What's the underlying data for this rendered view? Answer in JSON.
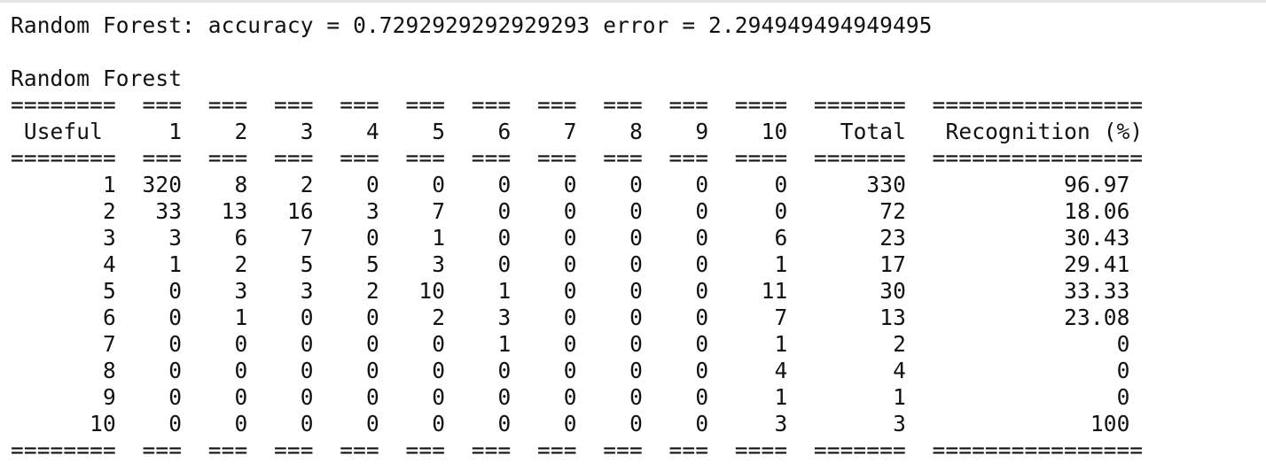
{
  "output": {
    "summary_line": "Random Forest: accuracy = 0.7292929292929293 error = 2.294949494949495",
    "table_title": "Random Forest",
    "separator": "========  ===  ===  ===  ===  ===  ===  ===  ===  ===  ====  =======  ================",
    "columns": [
      "Useful",
      "1",
      "2",
      "3",
      "4",
      "5",
      "6",
      "7",
      "8",
      "9",
      "10",
      "Total",
      "Recognition (%)"
    ],
    "rows": [
      [
        "1",
        "320",
        "8",
        "2",
        "0",
        "0",
        "0",
        "0",
        "0",
        "0",
        "0",
        "330",
        "96.97"
      ],
      [
        "2",
        "33",
        "13",
        "16",
        "3",
        "7",
        "0",
        "0",
        "0",
        "0",
        "0",
        "72",
        "18.06"
      ],
      [
        "3",
        "3",
        "6",
        "7",
        "0",
        "1",
        "0",
        "0",
        "0",
        "0",
        "6",
        "23",
        "30.43"
      ],
      [
        "4",
        "1",
        "2",
        "5",
        "5",
        "3",
        "0",
        "0",
        "0",
        "0",
        "1",
        "17",
        "29.41"
      ],
      [
        "5",
        "0",
        "3",
        "3",
        "2",
        "10",
        "1",
        "0",
        "0",
        "0",
        "11",
        "30",
        "33.33"
      ],
      [
        "6",
        "0",
        "1",
        "0",
        "0",
        "2",
        "3",
        "0",
        "0",
        "0",
        "7",
        "13",
        "23.08"
      ],
      [
        "7",
        "0",
        "0",
        "0",
        "0",
        "0",
        "1",
        "0",
        "0",
        "0",
        "1",
        "2",
        "0"
      ],
      [
        "8",
        "0",
        "0",
        "0",
        "0",
        "0",
        "0",
        "0",
        "0",
        "0",
        "4",
        "4",
        "0"
      ],
      [
        "9",
        "0",
        "0",
        "0",
        "0",
        "0",
        "0",
        "0",
        "0",
        "0",
        "1",
        "1",
        "0"
      ],
      [
        "10",
        "0",
        "0",
        "0",
        "0",
        "0",
        "0",
        "0",
        "0",
        "0",
        "3",
        "3",
        "100"
      ]
    ]
  }
}
